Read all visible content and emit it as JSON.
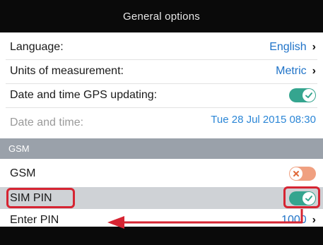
{
  "header": {
    "title": "General options"
  },
  "rows": {
    "language": {
      "label": "Language:",
      "value": "English"
    },
    "units": {
      "label": "Units of measurement:",
      "value": "Metric"
    },
    "gps_update": {
      "label": "Date and time GPS updating:",
      "state": "on"
    },
    "datetime": {
      "label": "Date and time:",
      "value": "Tue 28 Jul 2015 08:30"
    }
  },
  "section": {
    "title": "GSM"
  },
  "gsm_rows": {
    "gsm": {
      "label": "GSM",
      "state": "off"
    },
    "sim_pin": {
      "label": "SIM PIN",
      "state": "on"
    },
    "enter_pin": {
      "label": "Enter PIN",
      "value": "1000"
    }
  },
  "colors": {
    "toggle_on": "#35a58f",
    "toggle_off": "#f0a080",
    "accent": "#1f73c8",
    "highlight": "#d62432"
  }
}
